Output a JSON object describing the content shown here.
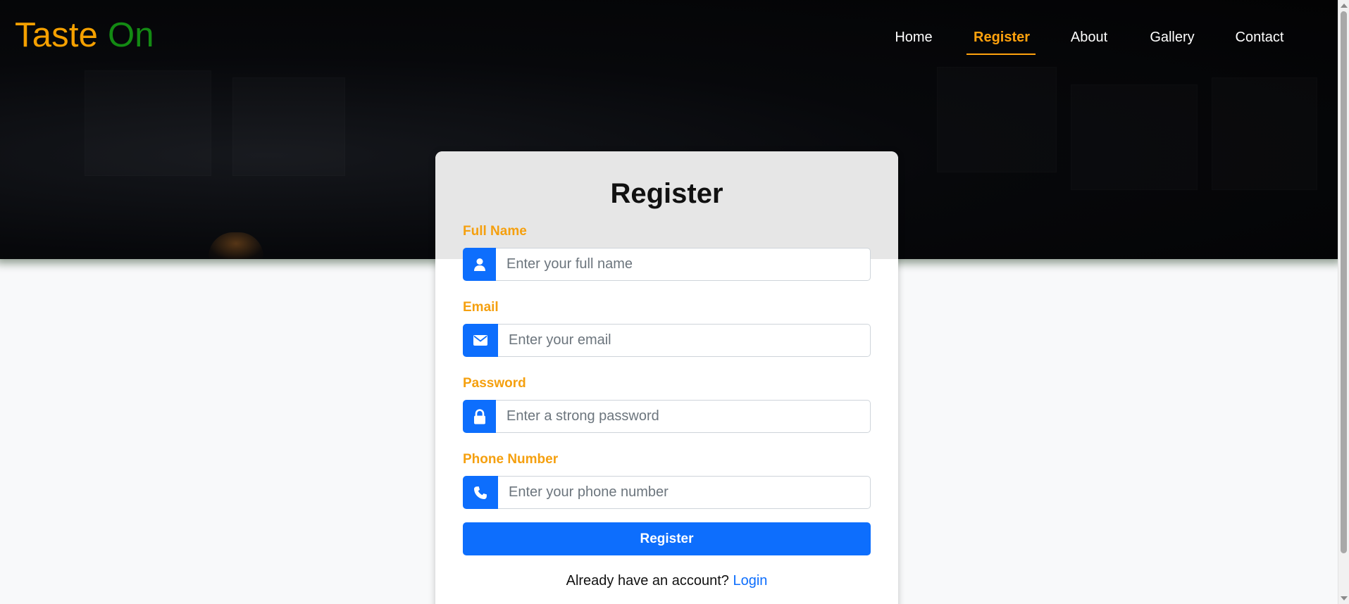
{
  "brand": {
    "word1": "Taste",
    "word2": "On"
  },
  "nav": {
    "items": [
      {
        "label": "Home"
      },
      {
        "label": "Register",
        "active": true
      },
      {
        "label": "About"
      },
      {
        "label": "Gallery"
      },
      {
        "label": "Contact"
      }
    ]
  },
  "form": {
    "title": "Register",
    "fields": [
      {
        "label": "Full Name",
        "placeholder": "Enter your full name",
        "icon": "user-icon"
      },
      {
        "label": "Email",
        "placeholder": "Enter your email",
        "icon": "envelope-icon"
      },
      {
        "label": "Password",
        "placeholder": "Enter a strong password",
        "icon": "lock-icon"
      },
      {
        "label": "Phone Number",
        "placeholder": "Enter your phone number",
        "icon": "phone-icon"
      }
    ],
    "submit_label": "Register",
    "footer_text": "Already have an account?",
    "login_link": "Login"
  },
  "colors": {
    "brand_orange": "#f5a000",
    "brand_green": "#138a13",
    "accent_blue": "#0d6efd",
    "label_orange": "#f5a00f"
  }
}
